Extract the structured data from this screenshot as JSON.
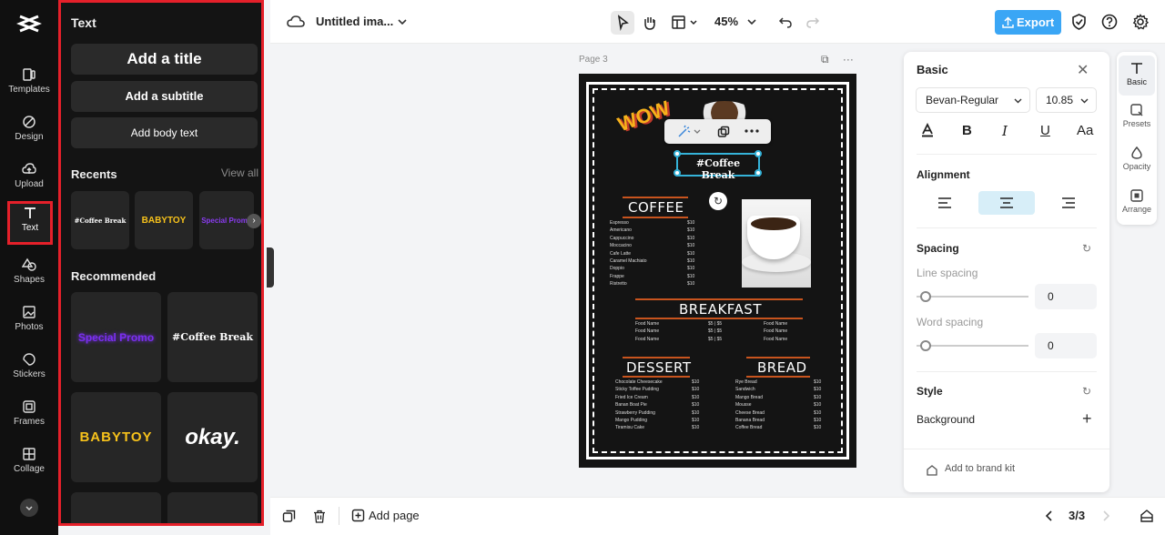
{
  "rail": {
    "items": [
      {
        "label": "Templates",
        "icon": "templates-icon"
      },
      {
        "label": "Design",
        "icon": "design-icon"
      },
      {
        "label": "Upload",
        "icon": "upload-icon"
      },
      {
        "label": "Text",
        "icon": "text-icon",
        "active": true
      },
      {
        "label": "Shapes",
        "icon": "shapes-icon"
      },
      {
        "label": "Photos",
        "icon": "photos-icon"
      },
      {
        "label": "Stickers",
        "icon": "stickers-icon"
      },
      {
        "label": "Frames",
        "icon": "frames-icon"
      },
      {
        "label": "Collage",
        "icon": "collage-icon"
      }
    ]
  },
  "text_panel": {
    "heading": "Text",
    "add_title": "Add a title",
    "add_subtitle": "Add a subtitle",
    "add_body": "Add body text",
    "recents_label": "Recents",
    "view_all": "View all",
    "recents": [
      "#Coffee Break",
      "BABYTOY",
      "Special Promo"
    ],
    "recommended_label": "Recommended",
    "recommended": [
      "Special Promo",
      "#Coffee Break",
      "BABYTOY",
      "okay."
    ]
  },
  "topbar": {
    "title": "Untitled ima...",
    "zoom": "45%",
    "export_label": "Export"
  },
  "canvas": {
    "page_label": "Page 3",
    "selected_text": "#Coffee Break",
    "wow": "WOW",
    "coffee_heading": "COFFEE",
    "coffee_items": [
      "Espresso",
      "Americano",
      "Cappuccino",
      "Moccacino",
      "Cafe Latte",
      "Caramel Machiato",
      "Doppio",
      "Frappe",
      "Ristretto"
    ],
    "coffee_price": "$10",
    "breakfast_heading": "BREAKFAST",
    "breakfast_item": "Food Name",
    "breakfast_price": "$5",
    "dessert_heading": "DESSERT",
    "dessert_items": [
      "Chocolate Cheesecake",
      "Sticky Toffee Pudding",
      "Fried Ice Cream",
      "Banan Boat Pie",
      "Strawberry Pudding",
      "Mango Pudding",
      "Tiramisu Cake"
    ],
    "bread_heading": "BREAD",
    "bread_items": [
      "Rye Bread",
      "Sandwich",
      "Mango Bread",
      "Mousse",
      "Cheese Bread",
      "Banana Bread",
      "Coffee Bread"
    ],
    "item_price": "$10"
  },
  "props": {
    "tab_title": "Basic",
    "font": "Bevan-Regular",
    "size": "10.85",
    "alignment_label": "Alignment",
    "spacing_label": "Spacing",
    "line_spacing_label": "Line spacing",
    "line_spacing": "0",
    "word_spacing_label": "Word spacing",
    "word_spacing": "0",
    "style_label": "Style",
    "background_label": "Background",
    "brand_kit": "Add to brand kit"
  },
  "right_rail": [
    "Basic",
    "Presets",
    "Opacity",
    "Arrange"
  ],
  "bottombar": {
    "add_page": "Add page",
    "page_counter": "3/3"
  },
  "colors": {
    "accent": "#3aa6f5",
    "highlight": "#e5202a",
    "selection": "#35b3d9"
  }
}
